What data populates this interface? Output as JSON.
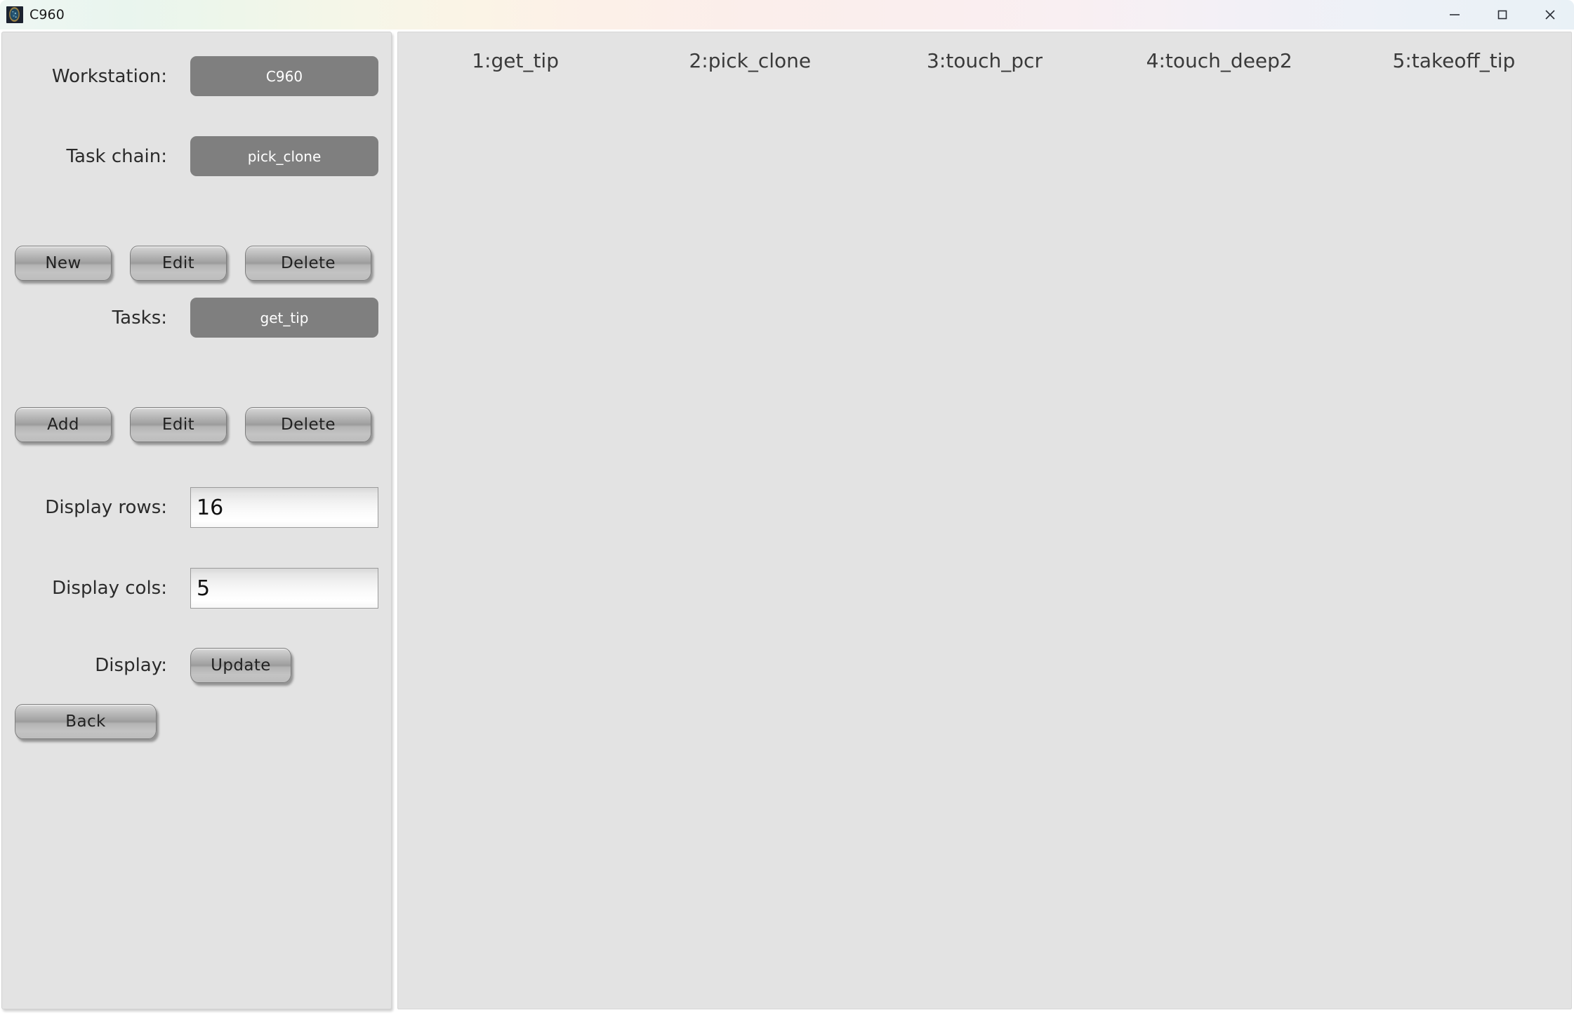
{
  "window": {
    "title": "C960",
    "icon": "app-icon",
    "controls": {
      "minimize": "minimize-icon",
      "maximize": "maximize-icon",
      "close": "close-icon"
    }
  },
  "sidebar": {
    "workstation": {
      "label": "Workstation:",
      "value": "C960"
    },
    "task_chain": {
      "label": "Task chain:",
      "value": "pick_clone"
    },
    "chain_buttons": [
      {
        "label": "New"
      },
      {
        "label": "Edit"
      },
      {
        "label": "Delete"
      }
    ],
    "tasks": {
      "label": "Tasks:",
      "value": "get_tip"
    },
    "task_buttons": [
      {
        "label": "Add"
      },
      {
        "label": "Edit"
      },
      {
        "label": "Delete"
      }
    ],
    "display_rows": {
      "label": "Display rows:",
      "value": "16"
    },
    "display_cols": {
      "label": "Display cols:",
      "value": "5"
    },
    "display": {
      "label": "Display:",
      "button": "Update"
    },
    "back_button": "Back"
  },
  "main": {
    "columns": [
      "1:get_tip",
      "2:pick_clone",
      "3:touch_pcr",
      "4:touch_deep2",
      "5:takeoff_tip"
    ],
    "rows": []
  },
  "colors": {
    "panel_bg": "#e3e3e3",
    "combo_bg": "#7f7f7f",
    "combo_text": "#ffffff",
    "label_text": "#2b2b2b",
    "header_text": "#3a3a3a"
  }
}
